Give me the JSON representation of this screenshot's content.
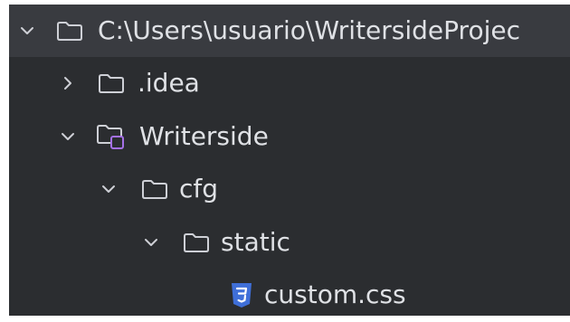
{
  "project_tree": {
    "items": [
      {
        "label": "C:\\Users\\usuario\\WritersideProjec",
        "icon": "folder-icon",
        "expanded": true
      },
      {
        "label": ".idea",
        "icon": "folder-icon",
        "expanded": false
      },
      {
        "label": "Writerside",
        "icon": "writerside-module-folder-icon",
        "expanded": true
      },
      {
        "label": "cfg",
        "icon": "folder-icon",
        "expanded": true
      },
      {
        "label": "static",
        "icon": "folder-icon",
        "expanded": true
      },
      {
        "label": "custom.css",
        "icon": "css-file-icon",
        "expanded": null
      }
    ]
  },
  "colors": {
    "background": "#2b2d30",
    "selection": "#393b40",
    "text": "#dfe1e5",
    "icon_stroke": "#ced0d6",
    "module_badge": "#a571e6",
    "css_icon": "#3f6fd8"
  }
}
